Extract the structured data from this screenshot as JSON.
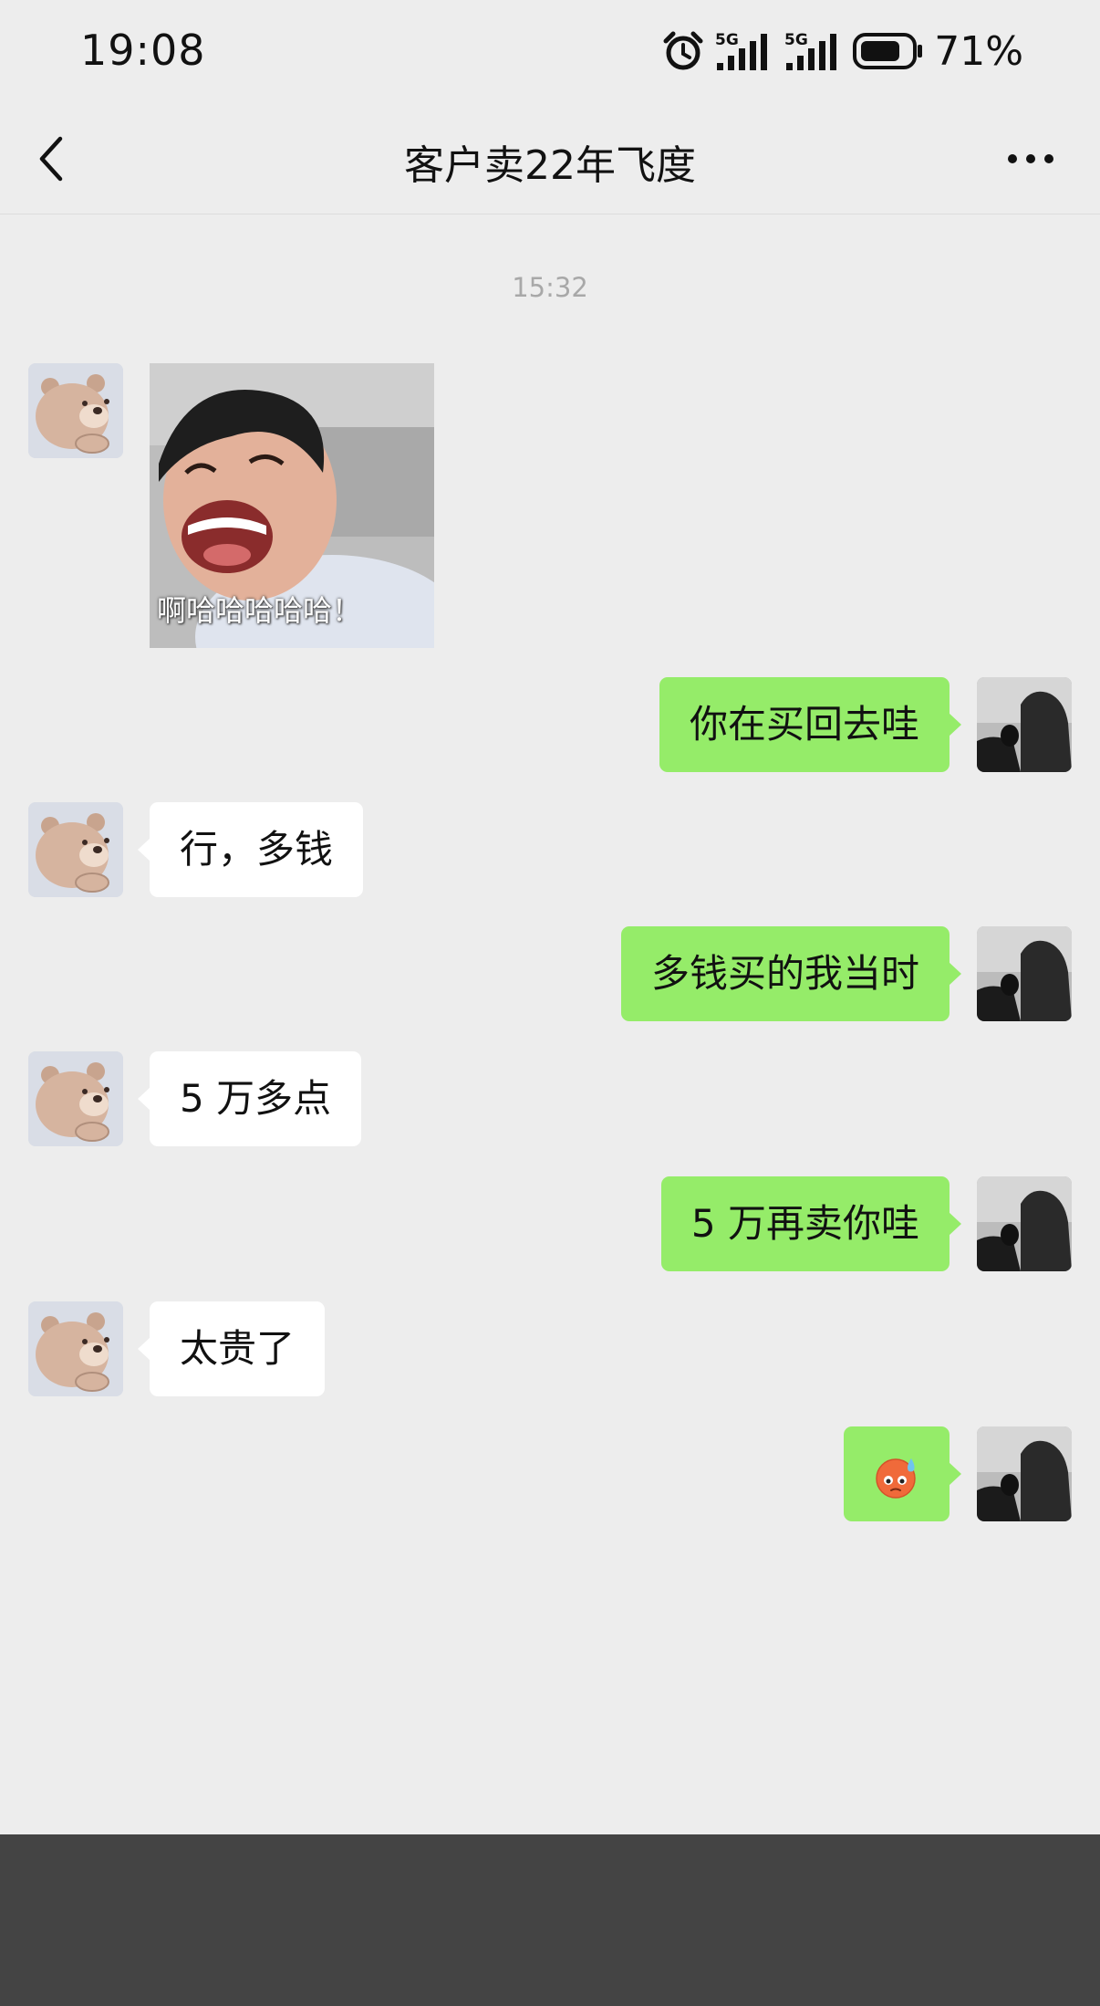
{
  "status_bar": {
    "time": "19:08",
    "network_1": "5G",
    "network_2": "5G",
    "battery_percent": "71%",
    "icons": [
      "alarm-icon",
      "signal-icon",
      "signal-icon",
      "battery-icon"
    ]
  },
  "nav": {
    "title": "客户卖22年飞度",
    "back_icon": "chevron-left-icon",
    "more_icon": "more-dots-icon"
  },
  "chat": {
    "timestamp": "15:32",
    "sticker_caption": "啊哈哈哈哈哈！",
    "messages": [
      {
        "side": "in",
        "type": "sticker"
      },
      {
        "side": "out",
        "text": "你在买回去哇"
      },
      {
        "side": "in",
        "text": "行，多钱"
      },
      {
        "side": "out",
        "text": "多钱买的我当时"
      },
      {
        "side": "in",
        "text": "5 万多点"
      },
      {
        "side": "out",
        "text": "5 万再卖你哇"
      },
      {
        "side": "in",
        "text": "太贵了"
      },
      {
        "side": "out",
        "type": "emoji",
        "emoji": "sweat-face-emoji"
      }
    ]
  },
  "colors": {
    "background": "#ededed",
    "bubble_out": "#95ec69",
    "bubble_in": "#ffffff",
    "footer": "#444444"
  }
}
